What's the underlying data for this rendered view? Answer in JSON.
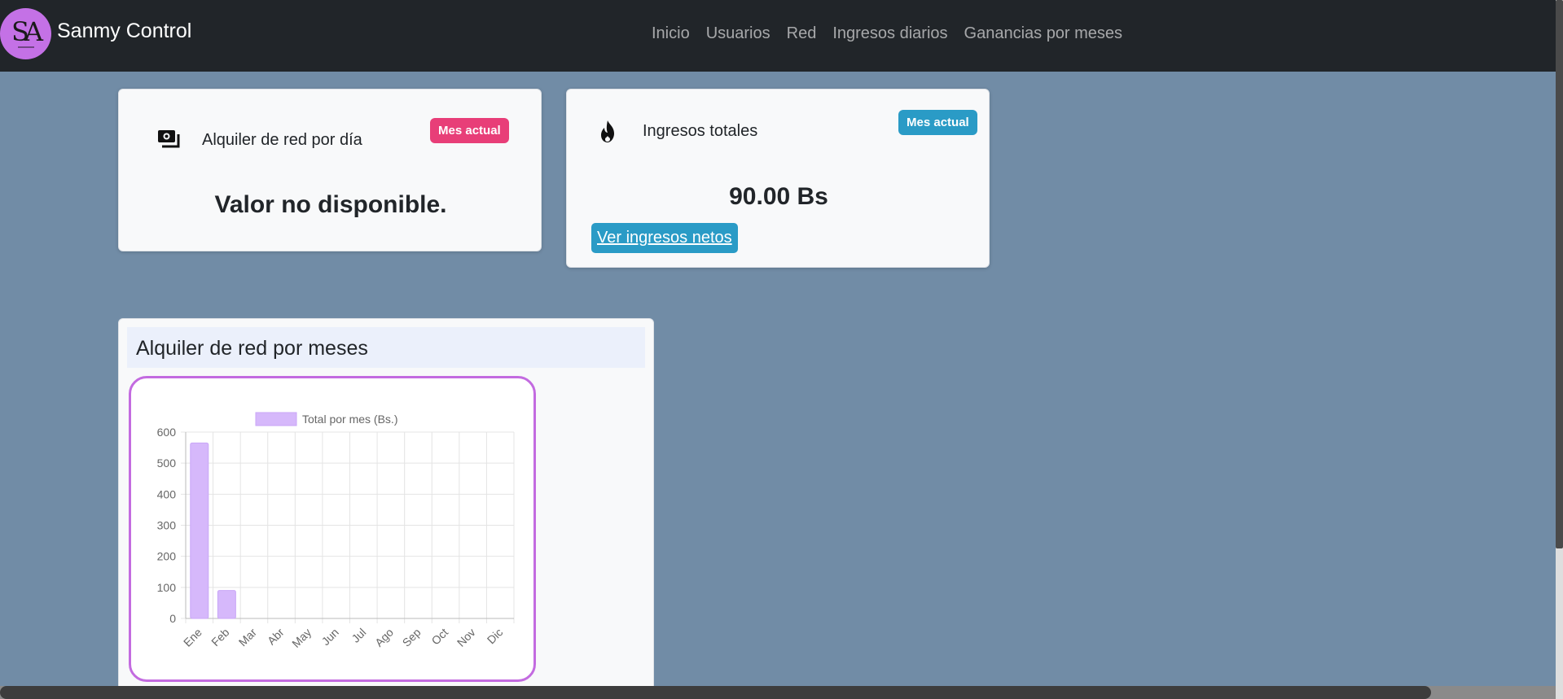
{
  "navbar": {
    "brand": "Sanmy Control",
    "logo_text": "SA",
    "links": [
      "Inicio",
      "Usuarios",
      "Red",
      "Ingresos diarios",
      "Ganancias por meses"
    ]
  },
  "cards": {
    "daily_rent": {
      "icon": "money-bill-icon",
      "title": "Alquiler de red por día",
      "badge": "Mes actual",
      "value": "Valor no disponible."
    },
    "total_income": {
      "icon": "fire-icon",
      "title": "Ingresos totales",
      "badge": "Mes actual",
      "value": "90.00 Bs",
      "button": "Ver ingresos netos"
    }
  },
  "monthly_chart": {
    "header": "Alquiler de red por meses"
  },
  "colors": {
    "navbar": "#212529",
    "page_background": "#718ca6",
    "badge_pink": "#e83e78",
    "badge_blue": "#2a9bc6",
    "bar_fill": "#d6b8fb",
    "chart_border": "#c36be0"
  },
  "chart_data": {
    "type": "bar",
    "categories": [
      "Ene",
      "Feb",
      "Mar",
      "Abr",
      "May",
      "Jun",
      "Jul",
      "Ago",
      "Sep",
      "Oct",
      "Nov",
      "Dic"
    ],
    "series": [
      {
        "name": "Total por mes (Bs.)",
        "values": [
          565,
          90,
          0,
          0,
          0,
          0,
          0,
          0,
          0,
          0,
          0,
          0
        ]
      }
    ],
    "yticks": [
      0,
      100,
      200,
      300,
      400,
      500,
      600
    ],
    "ylim": [
      0,
      600
    ],
    "legend": "top",
    "grid": true
  }
}
